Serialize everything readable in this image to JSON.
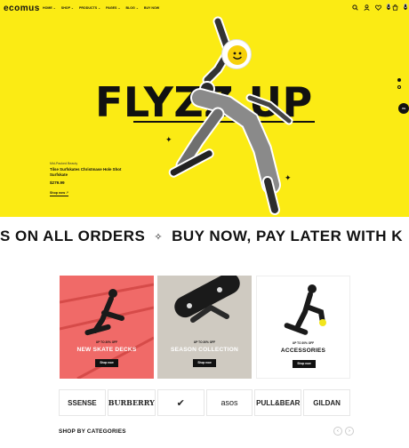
{
  "header": {
    "logo": "ecomus",
    "menu": [
      "HOME ⌄",
      "SHOP ⌄",
      "PRODUCTS ⌄",
      "PAGES ⌄",
      "BLOG ⌄",
      "BUY NOW"
    ],
    "cart_count": "0",
    "wishlist_count": "0"
  },
  "hero": {
    "title": "FLYZZ UP",
    "subtitle": "Mid-Packed Beauty",
    "product_name": "Tilse Surfskates Christmase Hole Shot Surfskate",
    "price": "$279.99",
    "shop_link": "Shop now ↗",
    "badge": "4%"
  },
  "marquee": {
    "text_left": "S ON ALL ORDERS",
    "star": "✧",
    "text_right": "BUY NOW, PAY LATER WITH K"
  },
  "cards": [
    {
      "tag": "UP TO 30% OFF",
      "name": "NEW SKATE DECKS",
      "button": "Shop now",
      "bg": "#f06a68"
    },
    {
      "tag": "UP TO 30% OFF",
      "name": "SEASON COLLECTION",
      "button": "Shop now",
      "bg": "#cfcac1"
    },
    {
      "tag": "UP TO 30% OFF",
      "name": "ACCESSORIES",
      "button": "Shop now",
      "bg": "#ffffff"
    }
  ],
  "brands": [
    "SSENSE",
    "BURBERRY",
    "✔",
    "asos",
    "PULL&BEAR",
    "GILDAN"
  ],
  "categories": {
    "title": "SHOP BY CATEGORIES",
    "prev": "‹",
    "next": "›"
  },
  "colors": {
    "hero_bg": "#fbeb14",
    "accent": "#111111"
  }
}
